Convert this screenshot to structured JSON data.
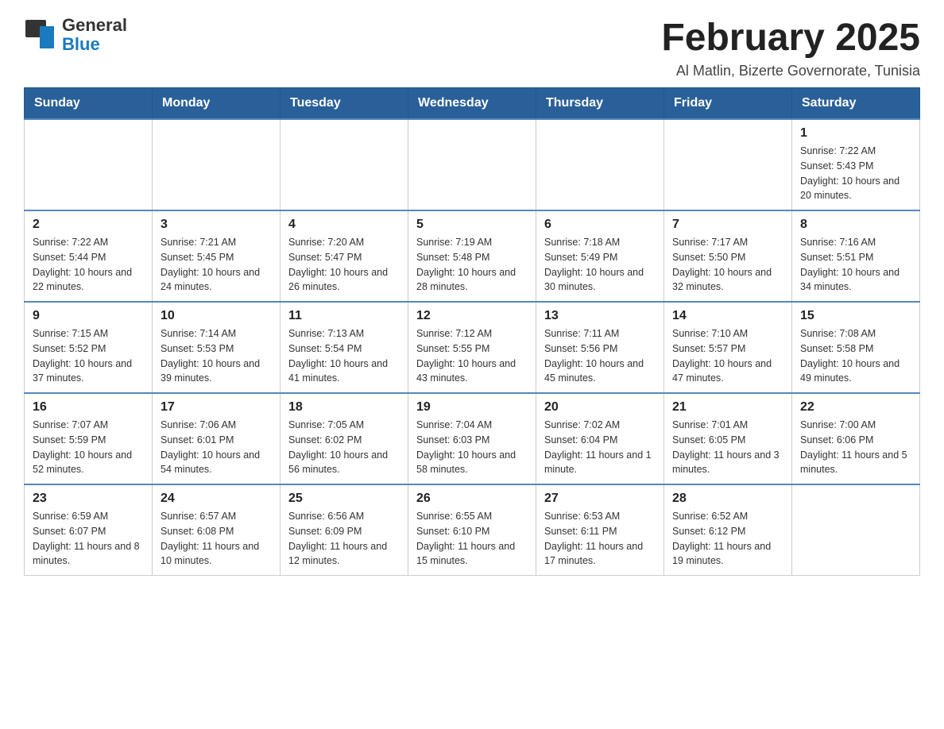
{
  "header": {
    "logo_general": "General",
    "logo_blue": "Blue",
    "calendar_title": "February 2025",
    "subtitle": "Al Matlin, Bizerte Governorate, Tunisia"
  },
  "days_of_week": [
    "Sunday",
    "Monday",
    "Tuesday",
    "Wednesday",
    "Thursday",
    "Friday",
    "Saturday"
  ],
  "weeks": [
    [
      {
        "day": "",
        "info": ""
      },
      {
        "day": "",
        "info": ""
      },
      {
        "day": "",
        "info": ""
      },
      {
        "day": "",
        "info": ""
      },
      {
        "day": "",
        "info": ""
      },
      {
        "day": "",
        "info": ""
      },
      {
        "day": "1",
        "info": "Sunrise: 7:22 AM\nSunset: 5:43 PM\nDaylight: 10 hours and 20 minutes."
      }
    ],
    [
      {
        "day": "2",
        "info": "Sunrise: 7:22 AM\nSunset: 5:44 PM\nDaylight: 10 hours and 22 minutes."
      },
      {
        "day": "3",
        "info": "Sunrise: 7:21 AM\nSunset: 5:45 PM\nDaylight: 10 hours and 24 minutes."
      },
      {
        "day": "4",
        "info": "Sunrise: 7:20 AM\nSunset: 5:47 PM\nDaylight: 10 hours and 26 minutes."
      },
      {
        "day": "5",
        "info": "Sunrise: 7:19 AM\nSunset: 5:48 PM\nDaylight: 10 hours and 28 minutes."
      },
      {
        "day": "6",
        "info": "Sunrise: 7:18 AM\nSunset: 5:49 PM\nDaylight: 10 hours and 30 minutes."
      },
      {
        "day": "7",
        "info": "Sunrise: 7:17 AM\nSunset: 5:50 PM\nDaylight: 10 hours and 32 minutes."
      },
      {
        "day": "8",
        "info": "Sunrise: 7:16 AM\nSunset: 5:51 PM\nDaylight: 10 hours and 34 minutes."
      }
    ],
    [
      {
        "day": "9",
        "info": "Sunrise: 7:15 AM\nSunset: 5:52 PM\nDaylight: 10 hours and 37 minutes."
      },
      {
        "day": "10",
        "info": "Sunrise: 7:14 AM\nSunset: 5:53 PM\nDaylight: 10 hours and 39 minutes."
      },
      {
        "day": "11",
        "info": "Sunrise: 7:13 AM\nSunset: 5:54 PM\nDaylight: 10 hours and 41 minutes."
      },
      {
        "day": "12",
        "info": "Sunrise: 7:12 AM\nSunset: 5:55 PM\nDaylight: 10 hours and 43 minutes."
      },
      {
        "day": "13",
        "info": "Sunrise: 7:11 AM\nSunset: 5:56 PM\nDaylight: 10 hours and 45 minutes."
      },
      {
        "day": "14",
        "info": "Sunrise: 7:10 AM\nSunset: 5:57 PM\nDaylight: 10 hours and 47 minutes."
      },
      {
        "day": "15",
        "info": "Sunrise: 7:08 AM\nSunset: 5:58 PM\nDaylight: 10 hours and 49 minutes."
      }
    ],
    [
      {
        "day": "16",
        "info": "Sunrise: 7:07 AM\nSunset: 5:59 PM\nDaylight: 10 hours and 52 minutes."
      },
      {
        "day": "17",
        "info": "Sunrise: 7:06 AM\nSunset: 6:01 PM\nDaylight: 10 hours and 54 minutes."
      },
      {
        "day": "18",
        "info": "Sunrise: 7:05 AM\nSunset: 6:02 PM\nDaylight: 10 hours and 56 minutes."
      },
      {
        "day": "19",
        "info": "Sunrise: 7:04 AM\nSunset: 6:03 PM\nDaylight: 10 hours and 58 minutes."
      },
      {
        "day": "20",
        "info": "Sunrise: 7:02 AM\nSunset: 6:04 PM\nDaylight: 11 hours and 1 minute."
      },
      {
        "day": "21",
        "info": "Sunrise: 7:01 AM\nSunset: 6:05 PM\nDaylight: 11 hours and 3 minutes."
      },
      {
        "day": "22",
        "info": "Sunrise: 7:00 AM\nSunset: 6:06 PM\nDaylight: 11 hours and 5 minutes."
      }
    ],
    [
      {
        "day": "23",
        "info": "Sunrise: 6:59 AM\nSunset: 6:07 PM\nDaylight: 11 hours and 8 minutes."
      },
      {
        "day": "24",
        "info": "Sunrise: 6:57 AM\nSunset: 6:08 PM\nDaylight: 11 hours and 10 minutes."
      },
      {
        "day": "25",
        "info": "Sunrise: 6:56 AM\nSunset: 6:09 PM\nDaylight: 11 hours and 12 minutes."
      },
      {
        "day": "26",
        "info": "Sunrise: 6:55 AM\nSunset: 6:10 PM\nDaylight: 11 hours and 15 minutes."
      },
      {
        "day": "27",
        "info": "Sunrise: 6:53 AM\nSunset: 6:11 PM\nDaylight: 11 hours and 17 minutes."
      },
      {
        "day": "28",
        "info": "Sunrise: 6:52 AM\nSunset: 6:12 PM\nDaylight: 11 hours and 19 minutes."
      },
      {
        "day": "",
        "info": ""
      }
    ]
  ]
}
